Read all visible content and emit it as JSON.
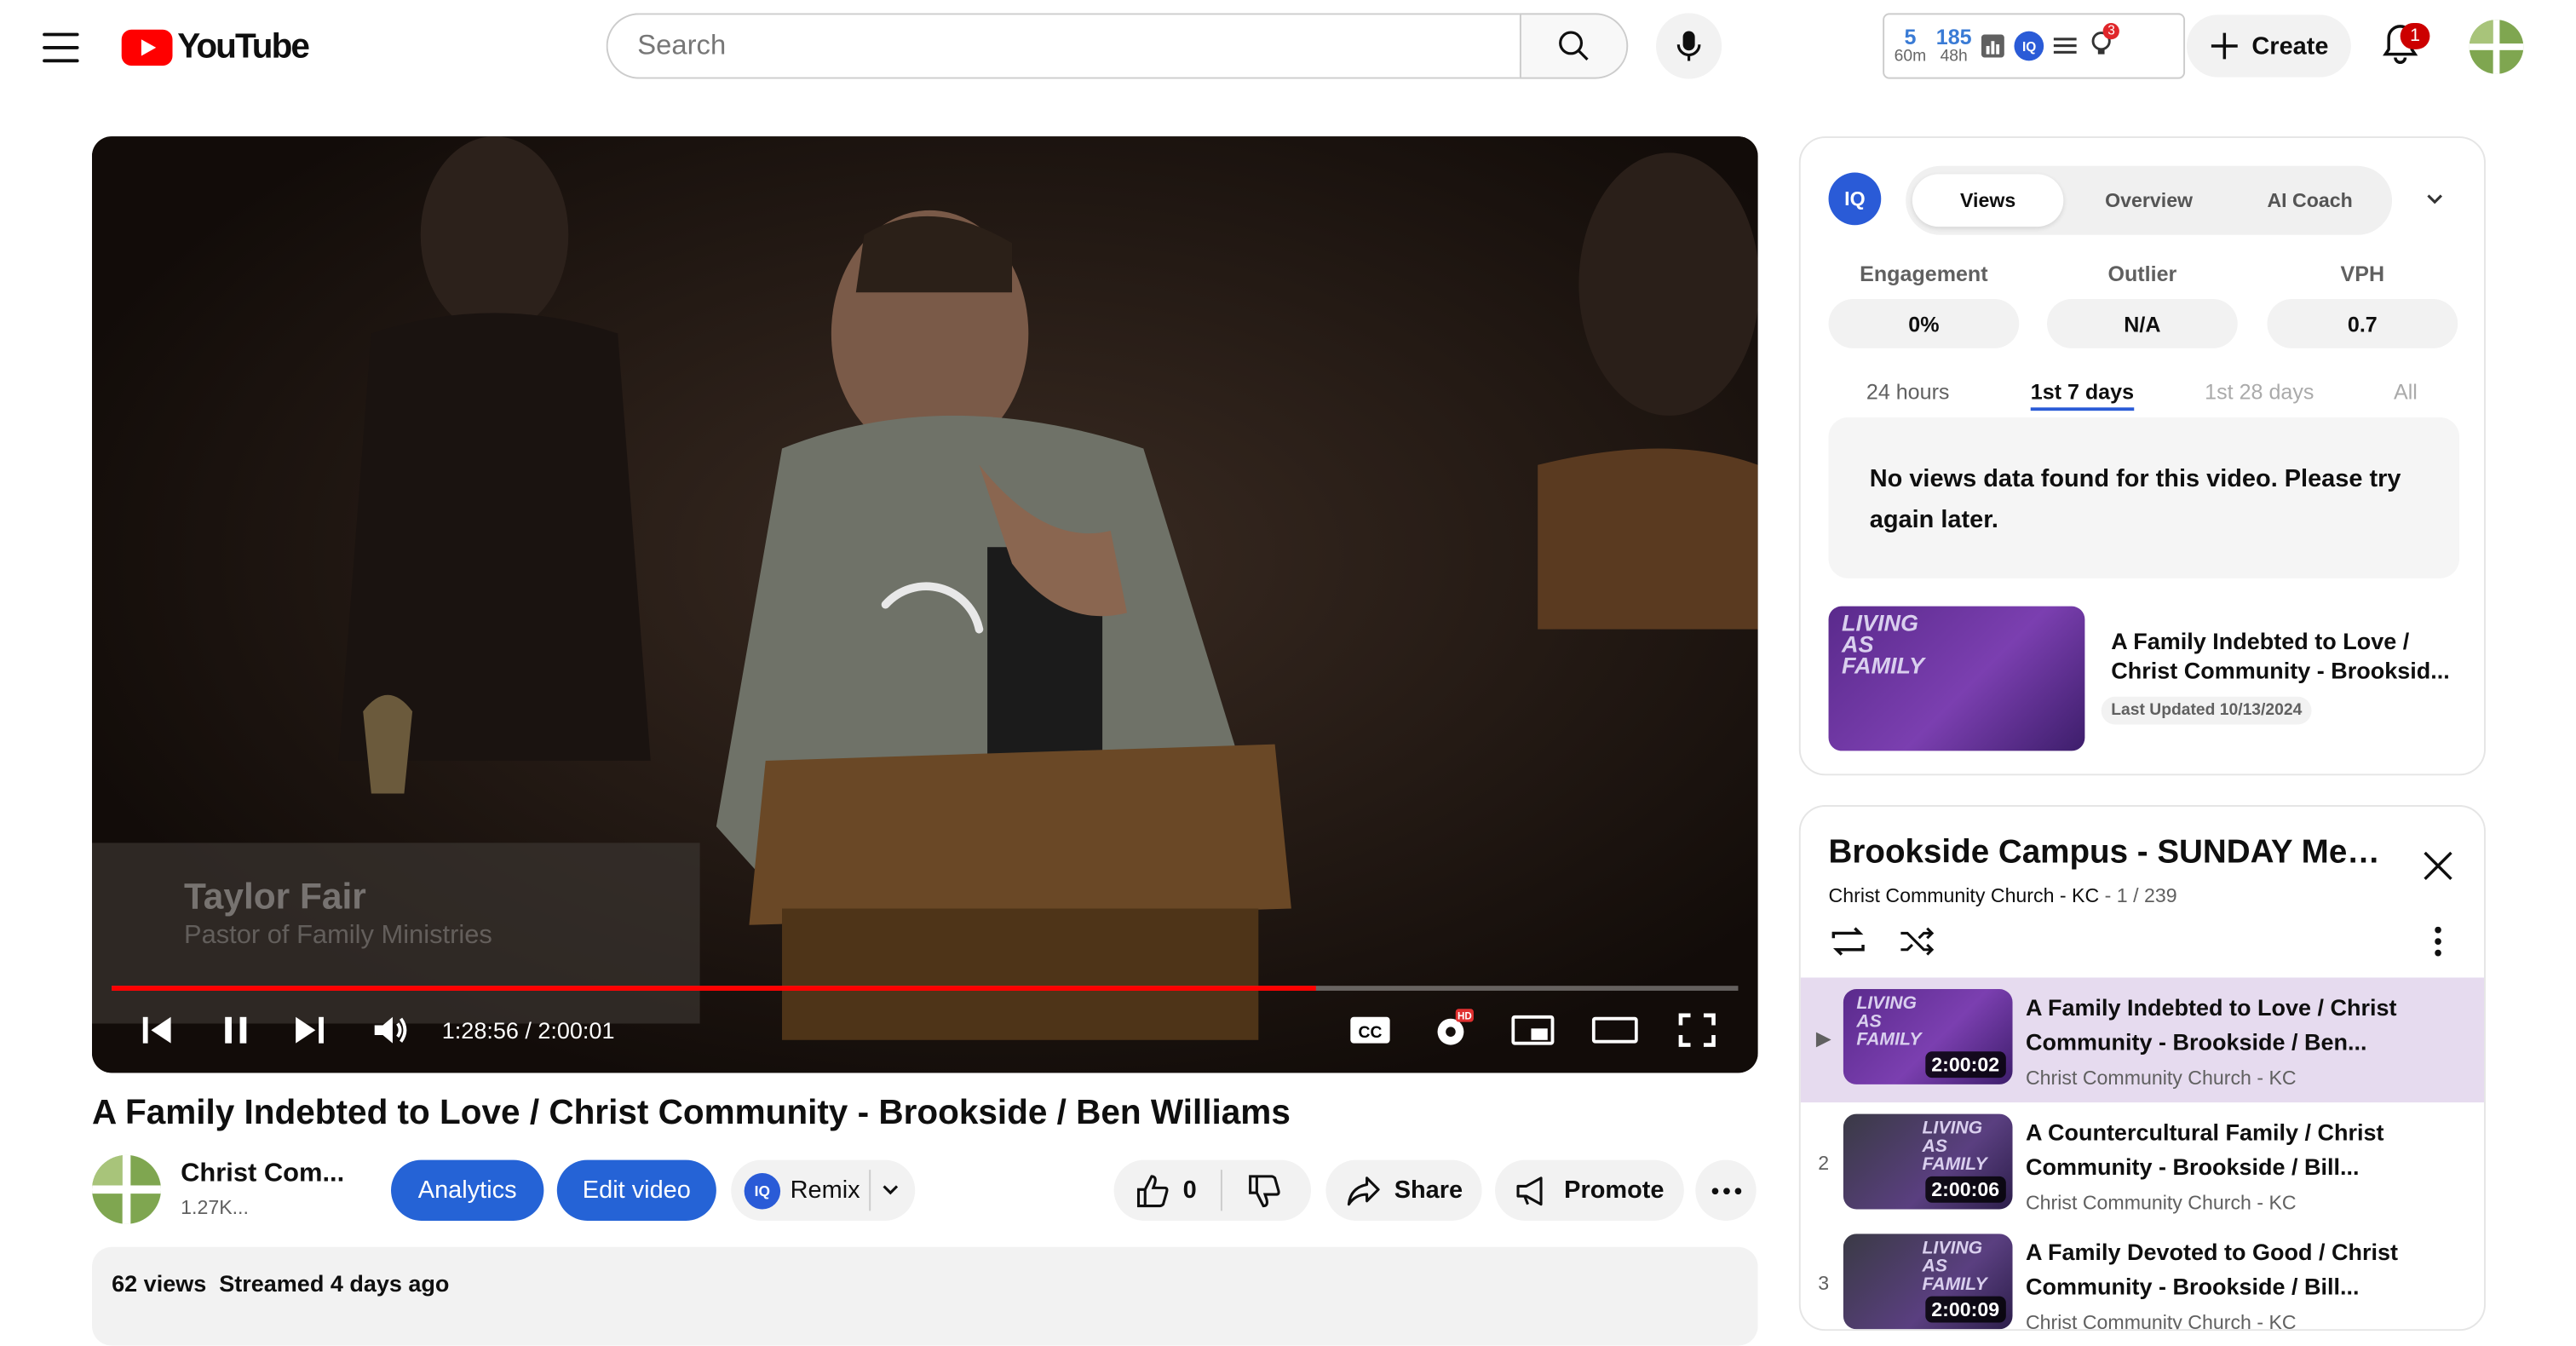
{
  "header": {
    "logo_text": "YouTube",
    "search_placeholder": "Search",
    "ext": {
      "stat1_num": "5",
      "stat1_lbl": "60m",
      "stat2_num": "185",
      "stat2_lbl": "48h",
      "notif_badge": "3"
    },
    "create_label": "Create",
    "bell_badge": "1"
  },
  "player": {
    "current_time": "1:28:56",
    "duration": "2:00:01",
    "time_display": "1:28:56 / 2:00:01",
    "progress": 0.74,
    "lower_third_name": "Taylor Fair",
    "lower_third_role": "Pastor of Family Ministries"
  },
  "video": {
    "title": "A Family Indebted to Love / Christ Community - Brookside / Ben Williams",
    "channel_name": "Christ Com...",
    "channel_subs": "1.27K...",
    "analytics_label": "Analytics",
    "edit_label": "Edit video",
    "remix_label": "Remix",
    "likes": "0",
    "share_label": "Share",
    "promote_label": "Promote",
    "views": "62 views",
    "streamed": "Streamed 4 days ago"
  },
  "iq_panel": {
    "logo_text": "IQ",
    "tabs": [
      "Views",
      "Overview",
      "AI Coach"
    ],
    "metrics": [
      {
        "label": "Engagement",
        "value": "0%"
      },
      {
        "label": "Outlier",
        "value": "N/A"
      },
      {
        "label": "VPH",
        "value": "0.7"
      }
    ],
    "ranges": [
      "24 hours",
      "1st 7 days",
      "1st 28 days",
      "All"
    ],
    "no_data": "No views data found for this video. Please try again later.",
    "card_title": "A Family Indebted to Love / Christ Community - Brooksid...",
    "card_updated": "Last Updated 10/13/2024",
    "thumb_text": "LIVING AS FAMILY"
  },
  "playlist": {
    "title": "Brookside Campus - SUNDAY Messa...",
    "channel": "Christ Community Church - KC",
    "position": "1 / 239",
    "items": [
      {
        "index": "▶",
        "title": "A Family Indebted to Love / Christ Community - Brookside / Ben...",
        "channel": "Christ Community Church - KC",
        "duration": "2:00:02"
      },
      {
        "index": "2",
        "title": "A Countercultural Family / Christ Community - Brookside / Bill...",
        "channel": "Christ Community Church - KC",
        "duration": "2:00:06"
      },
      {
        "index": "3",
        "title": "A Family Devoted to Good / Christ Community - Brookside / Bill...",
        "channel": "Christ Community Church - KC",
        "duration": "2:00:09"
      }
    ]
  },
  "colors": {
    "accent_blue": "#2563d6",
    "progress_red": "#ff0000",
    "playlist_active": "#e6dbef"
  }
}
